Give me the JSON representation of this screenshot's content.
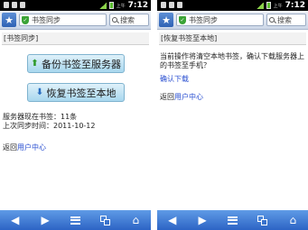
{
  "status_bar": {
    "ampm": "上午",
    "time": "7:12"
  },
  "toolbar": {
    "url_text": "书签同步",
    "search_placeholder": "搜索"
  },
  "left_page": {
    "heading": "[书签同步]",
    "backup_button_label": "备份书签至服务器",
    "restore_button_label": "恢复书签至本地",
    "server_bookmark_count": "服务器现在书签：11条",
    "last_sync_time": "上次同步时间：2011-10-12",
    "return_prefix": "返回",
    "user_center_link": "用户中心"
  },
  "right_page": {
    "heading": "[恢复书签至本地]",
    "confirm_message": "当前操作将清空本地书签，确认下载服务器上的书签至手机？",
    "confirm_download_link": "确认下载",
    "return_prefix": "返回",
    "user_center_link": "用户中心"
  },
  "icons": [
    "star-icon",
    "shield-icon",
    "search-icon",
    "back-arrow-icon",
    "forward-arrow-icon",
    "menu-icon",
    "tabs-icon",
    "home-icon"
  ],
  "colors": {
    "toolbar_blue": "#2d64c5",
    "link_blue": "#2a4fd1",
    "shield_green": "#3aa335",
    "button_blue": "#a8d7ee"
  }
}
